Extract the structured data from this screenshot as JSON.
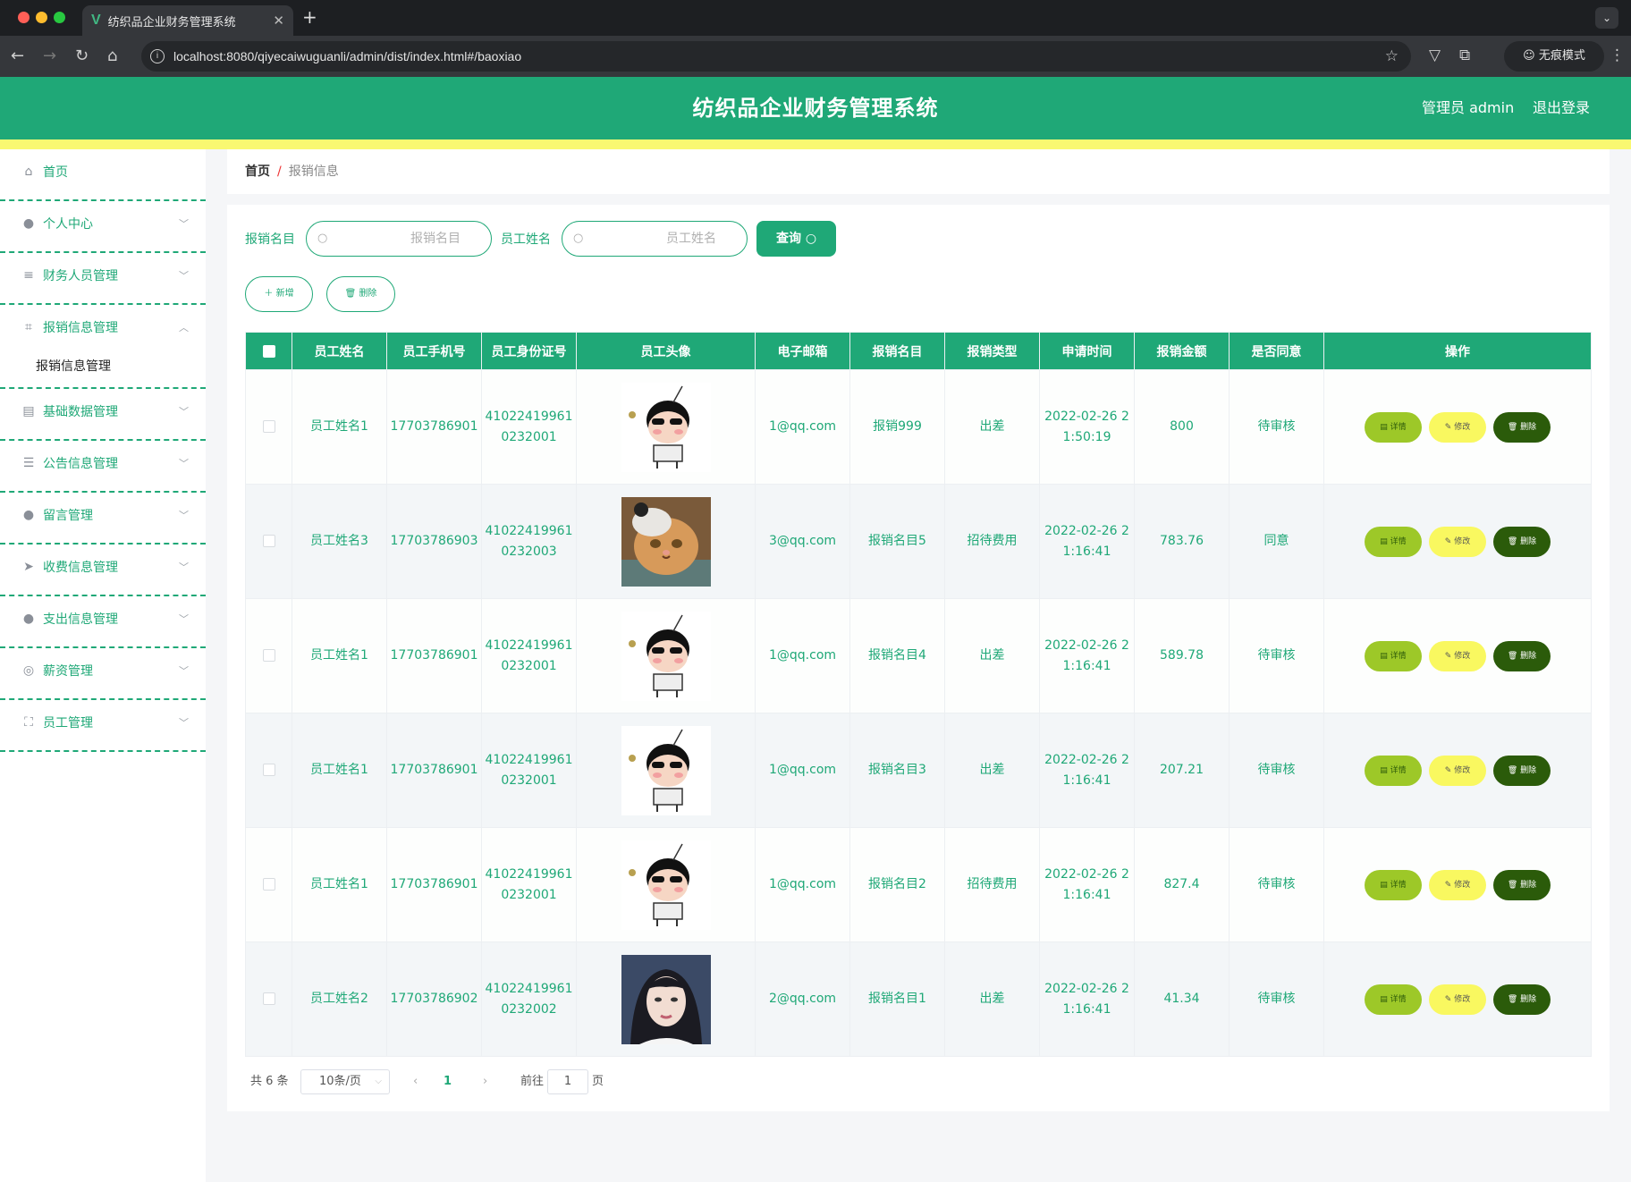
{
  "browser": {
    "tab_title": "纺织品企业财务管理系统",
    "url": "localhost:8080/qiyecaiwuguanli/admin/dist/index.html#/baoxiao",
    "incognito_label": "无痕模式"
  },
  "header": {
    "title": "纺织品企业财务管理系统",
    "admin_label": "管理员 admin",
    "logout_label": "退出登录"
  },
  "sidebar": {
    "items": [
      {
        "label": "首页",
        "icon": "home-icon"
      },
      {
        "label": "个人中心",
        "icon": "user-icon"
      },
      {
        "label": "财务人员管理",
        "icon": "sliders-icon"
      },
      {
        "label": "报销信息管理",
        "icon": "crop-icon"
      },
      {
        "label": "基础数据管理",
        "icon": "document-icon"
      },
      {
        "label": "公告信息管理",
        "icon": "list-icon"
      },
      {
        "label": "留言管理",
        "icon": "user-icon"
      },
      {
        "label": "收费信息管理",
        "icon": "send-icon"
      },
      {
        "label": "支出信息管理",
        "icon": "user-icon"
      },
      {
        "label": "薪资管理",
        "icon": "compass-icon"
      },
      {
        "label": "员工管理",
        "icon": "fullscreen-icon"
      }
    ],
    "submenu_label": "报销信息管理"
  },
  "breadcrumb": {
    "home": "首页",
    "separator": "/",
    "current": "报销信息"
  },
  "search": {
    "name_label": "报销名目",
    "name_placeholder": "报销名目",
    "employee_label": "员工姓名",
    "employee_placeholder": "员工姓名",
    "query_button": "查询"
  },
  "actions": {
    "add": "新增",
    "delete": "删除"
  },
  "table": {
    "columns": [
      "员工姓名",
      "员工手机号",
      "员工身份证号",
      "员工头像",
      "电子邮箱",
      "报销名目",
      "报销类型",
      "申请时间",
      "报销金额",
      "是否同意",
      "操作"
    ],
    "op_labels": {
      "detail": "详情",
      "edit": "修改",
      "delete": "删除"
    },
    "rows": [
      {
        "name": "员工姓名1",
        "phone": "17703786901",
        "id_card": "410224199610232001",
        "avatar": "cartoon-boy",
        "email": "1@qq.com",
        "item": "报销999",
        "type": "出差",
        "time": "2022-02-26 21:50:19",
        "amount": "800",
        "status": "待审核"
      },
      {
        "name": "员工姓名3",
        "phone": "17703786903",
        "id_card": "410224199610232003",
        "avatar": "cat-photo",
        "email": "3@qq.com",
        "item": "报销名目5",
        "type": "招待费用",
        "time": "2022-02-26 21:16:41",
        "amount": "783.76",
        "status": "同意"
      },
      {
        "name": "员工姓名1",
        "phone": "17703786901",
        "id_card": "410224199610232001",
        "avatar": "cartoon-boy",
        "email": "1@qq.com",
        "item": "报销名目4",
        "type": "出差",
        "time": "2022-02-26 21:16:41",
        "amount": "589.78",
        "status": "待审核"
      },
      {
        "name": "员工姓名1",
        "phone": "17703786901",
        "id_card": "410224199610232001",
        "avatar": "cartoon-boy",
        "email": "1@qq.com",
        "item": "报销名目3",
        "type": "出差",
        "time": "2022-02-26 21:16:41",
        "amount": "207.21",
        "status": "待审核"
      },
      {
        "name": "员工姓名1",
        "phone": "17703786901",
        "id_card": "410224199610232001",
        "avatar": "cartoon-boy",
        "email": "1@qq.com",
        "item": "报销名目2",
        "type": "招待费用",
        "time": "2022-02-26 21:16:41",
        "amount": "827.4",
        "status": "待审核"
      },
      {
        "name": "员工姓名2",
        "phone": "17703786902",
        "id_card": "410224199610232002",
        "avatar": "girl-photo",
        "email": "2@qq.com",
        "item": "报销名目1",
        "type": "出差",
        "time": "2022-02-26 21:16:41",
        "amount": "41.34",
        "status": "待审核"
      }
    ]
  },
  "pagination": {
    "total": "共 6 条",
    "page_size": "10条/页",
    "current_page": "1",
    "goto_label": "前往",
    "goto_value": "1",
    "page_suffix": "页"
  },
  "colors": {
    "primary": "#1fa877",
    "accent_yellow": "#f9f871",
    "detail_btn": "#9dc828",
    "edit_btn": "#f9f860",
    "delete_btn": "#2b5b0a"
  }
}
